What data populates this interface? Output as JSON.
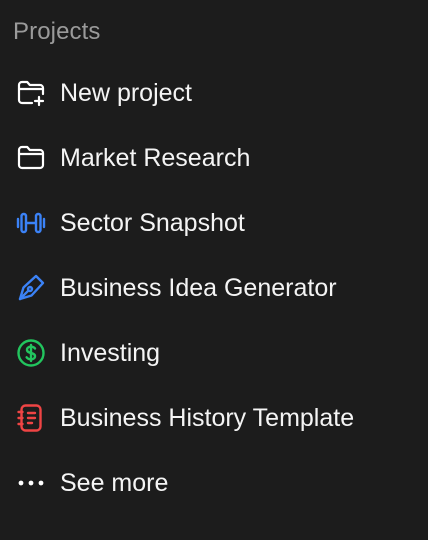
{
  "section": {
    "title": "Projects"
  },
  "items": [
    {
      "label": "New project",
      "icon": "folder-plus-icon",
      "color": "#ffffff"
    },
    {
      "label": "Market Research",
      "icon": "folder-icon",
      "color": "#ffffff"
    },
    {
      "label": "Sector Snapshot",
      "icon": "dumbbell-icon",
      "color": "#3b82f6"
    },
    {
      "label": "Business Idea Generator",
      "icon": "pen-nib-icon",
      "color": "#3b82f6"
    },
    {
      "label": "Investing",
      "icon": "dollar-circle-icon",
      "color": "#22c55e"
    },
    {
      "label": "Business History Template",
      "icon": "notebook-icon",
      "color": "#ef4444"
    },
    {
      "label": "See more",
      "icon": "more-horizontal-icon",
      "color": "#ffffff"
    }
  ]
}
